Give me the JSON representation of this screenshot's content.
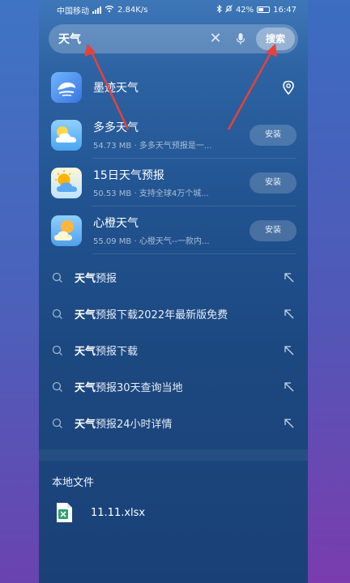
{
  "status_bar": {
    "carrier": "中国移动",
    "network": "⁴ᴳ",
    "speed": "2.84K/s",
    "battery": "42%",
    "time": "16:47"
  },
  "search": {
    "query": "天气",
    "button_label": "搜索"
  },
  "apps": [
    {
      "name": "墨迹天气",
      "meta": "",
      "action": ""
    },
    {
      "name": "多多天气",
      "meta": "54.73 MB · 多多天气预报是一...",
      "action": "安装"
    },
    {
      "name": "15日天气预报",
      "meta": "50.53 MB · 支持全球4万个城...",
      "action": "安装"
    },
    {
      "name": "心橙天气",
      "meta": "55.09 MB · 心橙天气--一款内...",
      "action": "安装"
    }
  ],
  "suggestions": [
    {
      "keyword": "天气",
      "rest": "预报"
    },
    {
      "keyword": "天气",
      "rest": "预报下载2022年最新版免费"
    },
    {
      "keyword": "天气",
      "rest": "预报下载"
    },
    {
      "keyword": "天气",
      "rest": "预报30天查询当地"
    },
    {
      "keyword": "天气",
      "rest": "预报24小时详情"
    }
  ],
  "local_files": {
    "title": "本地文件",
    "files": [
      {
        "name": "11.11.xlsx"
      }
    ]
  },
  "icons": {
    "clear": "close-icon",
    "mic": "microphone-icon",
    "location": "location-pin-icon",
    "suggestion": "search-icon",
    "fill": "arrow-up-left-icon",
    "file": "xlsx-file-icon"
  },
  "colors": {
    "annotation_arrow": "#e8413a",
    "file_icon": "#2aa36a"
  }
}
